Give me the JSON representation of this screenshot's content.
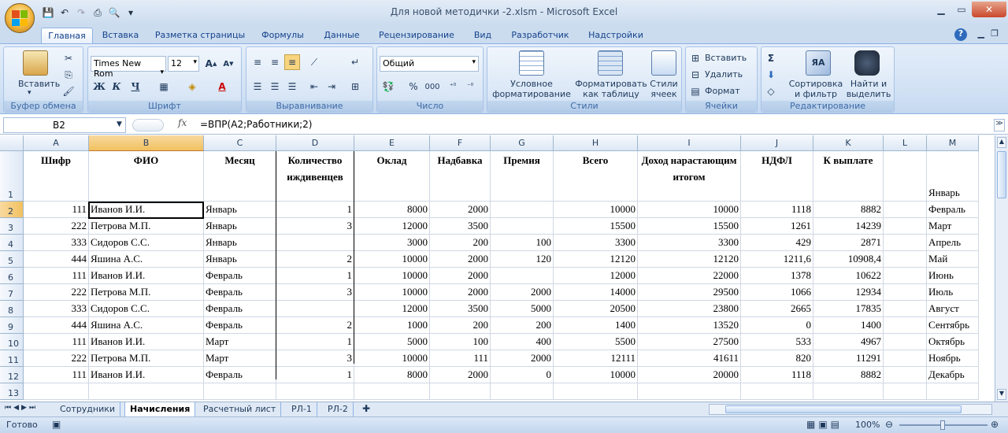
{
  "window": {
    "title": "Для новой методички -2.xlsm - Microsoft Excel"
  },
  "tabs": [
    "Главная",
    "Вставка",
    "Разметка страницы",
    "Формулы",
    "Данные",
    "Рецензирование",
    "Вид",
    "Разработчик",
    "Надстройки"
  ],
  "ribbon": {
    "clipboard": {
      "paste": "Вставить",
      "label": "Буфер обмена"
    },
    "font": {
      "name": "Times New Rom",
      "size": "12",
      "bold": "Ж",
      "italic": "К",
      "underline": "Ч",
      "label": "Шрифт"
    },
    "alignment": {
      "label": "Выравнивание"
    },
    "number": {
      "format": "Общий",
      "percent": "%",
      "thousands": "000",
      "label": "Число"
    },
    "styles": {
      "conditional": "Условное форматирование",
      "astable": "Форматировать как таблицу",
      "cellstyles": "Стили ячеек",
      "label": "Стили"
    },
    "cells": {
      "insert": "Вставить",
      "delete": "Удалить",
      "format": "Формат",
      "label": "Ячейки"
    },
    "editing": {
      "sum": "Σ",
      "sort": "Сортировка и фильтр",
      "find": "Найти и выделить",
      "label": "Редактирование"
    }
  },
  "formula_bar": {
    "name_box": "B2",
    "fx": "fx",
    "formula": "=ВПР(A2;Работники;2)"
  },
  "columns": [
    "A",
    "B",
    "C",
    "D",
    "E",
    "F",
    "G",
    "H",
    "I",
    "J",
    "K",
    "L",
    "M"
  ],
  "header_row": {
    "row": "1",
    "cells": [
      "Шифр",
      "ФИО",
      "Месяц",
      "Количество иждивенцев",
      "Оклад",
      "Надбавка",
      "Премия",
      "Всего",
      "Доход нарастающим итогом",
      "НДФЛ",
      "К выплате",
      "",
      "Январь"
    ]
  },
  "rows": [
    {
      "n": "2",
      "cells": [
        "111",
        "Иванов И.И.",
        "Январь",
        "1",
        "8000",
        "2000",
        "",
        "10000",
        "10000",
        "1118",
        "8882",
        "",
        "Февраль"
      ]
    },
    {
      "n": "3",
      "cells": [
        "222",
        "Петрова М.П.",
        "Январь",
        "3",
        "12000",
        "3500",
        "",
        "15500",
        "15500",
        "1261",
        "14239",
        "",
        "Март"
      ]
    },
    {
      "n": "4",
      "cells": [
        "333",
        "Сидоров С.С.",
        "Январь",
        "",
        "3000",
        "200",
        "100",
        "3300",
        "3300",
        "429",
        "2871",
        "",
        "Апрель"
      ]
    },
    {
      "n": "5",
      "cells": [
        "444",
        "Яшина А.С.",
        "Январь",
        "2",
        "10000",
        "2000",
        "120",
        "12120",
        "12120",
        "1211,6",
        "10908,4",
        "",
        "Май"
      ]
    },
    {
      "n": "6",
      "cells": [
        "111",
        "Иванов И.И.",
        "Февраль",
        "1",
        "10000",
        "2000",
        "",
        "12000",
        "22000",
        "1378",
        "10622",
        "",
        "Июнь"
      ]
    },
    {
      "n": "7",
      "cells": [
        "222",
        "Петрова М.П.",
        "Февраль",
        "3",
        "10000",
        "2000",
        "2000",
        "14000",
        "29500",
        "1066",
        "12934",
        "",
        "Июль"
      ]
    },
    {
      "n": "8",
      "cells": [
        "333",
        "Сидоров С.С.",
        "Февраль",
        "",
        "12000",
        "3500",
        "5000",
        "20500",
        "23800",
        "2665",
        "17835",
        "",
        "Август"
      ]
    },
    {
      "n": "9",
      "cells": [
        "444",
        "Яшина А.С.",
        "Февраль",
        "2",
        "1000",
        "200",
        "200",
        "1400",
        "13520",
        "0",
        "1400",
        "",
        "Сентябрь"
      ]
    },
    {
      "n": "10",
      "cells": [
        "111",
        "Иванов И.И.",
        "Март",
        "1",
        "5000",
        "100",
        "400",
        "5500",
        "27500",
        "533",
        "4967",
        "",
        "Октябрь"
      ]
    },
    {
      "n": "11",
      "cells": [
        "222",
        "Петрова М.П.",
        "Март",
        "3",
        "10000",
        "111",
        "2000",
        "12111",
        "41611",
        "820",
        "11291",
        "",
        "Ноябрь"
      ]
    },
    {
      "n": "12",
      "cells": [
        "111",
        "Иванов И.И.",
        "Февраль",
        "1",
        "8000",
        "2000",
        "0",
        "10000",
        "20000",
        "1118",
        "8882",
        "",
        "Декабрь"
      ]
    },
    {
      "n": "13",
      "cells": [
        "",
        "",
        "",
        "",
        "",
        "",
        "",
        "",
        "",
        "",
        "",
        "",
        ""
      ]
    }
  ],
  "sheets": [
    "Сотрудники",
    "Начисления",
    "Расчетный лист",
    "РЛ-1",
    "РЛ-2"
  ],
  "active_sheet": "Начисления",
  "status": {
    "ready": "Готово",
    "zoom": "100%"
  }
}
